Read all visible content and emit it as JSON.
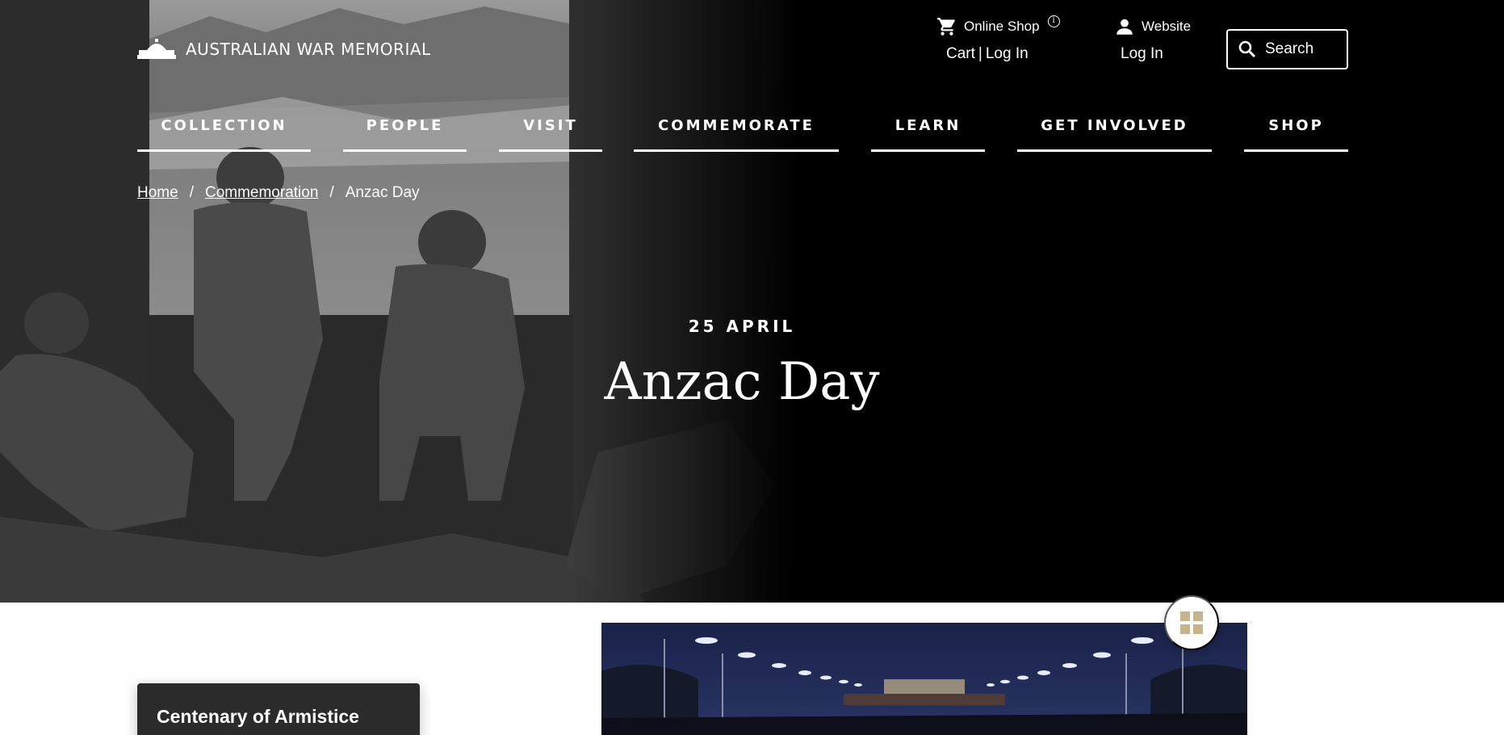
{
  "brand": {
    "name": "AUSTRALIAN WAR MEMORIAL"
  },
  "utility": {
    "shop": {
      "label": "Online Shop",
      "info": "i",
      "cart": "Cart",
      "separator": "|",
      "login": "Log In"
    },
    "account": {
      "label": "Website",
      "login": "Log In"
    },
    "search": {
      "label": "Search"
    }
  },
  "nav": {
    "items": [
      {
        "label": "COLLECTION"
      },
      {
        "label": "PEOPLE"
      },
      {
        "label": "VISIT"
      },
      {
        "label": "COMMEMORATE"
      },
      {
        "label": "LEARN"
      },
      {
        "label": "GET INVOLVED"
      },
      {
        "label": "SHOP"
      }
    ]
  },
  "breadcrumb": {
    "home": "Home",
    "separator": "/",
    "section": "Commemoration",
    "current": "Anzac Day"
  },
  "hero": {
    "kicker": "25 APRIL",
    "title": "Anzac Day"
  },
  "sidebar": {
    "card_title": "Centenary of Armistice"
  },
  "colors": {
    "hero_bg": "#000000",
    "card_bg": "#2b2b2b",
    "grid_icon": "#c8b48a",
    "night_sky": "#1a2248"
  },
  "icons": [
    "memorial-logo-icon",
    "cart-icon",
    "info-icon",
    "person-icon",
    "search-icon",
    "grid-icon"
  ]
}
